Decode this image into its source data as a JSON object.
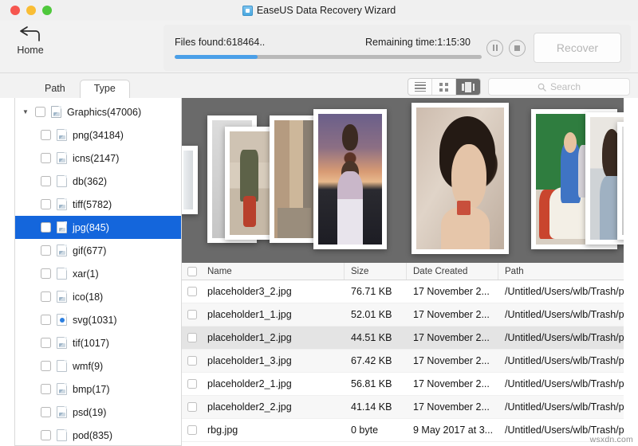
{
  "window": {
    "title": "EaseUS Data Recovery Wizard",
    "app_icon": "app-icon",
    "traffic_lights": [
      "close",
      "minimize",
      "maximize"
    ]
  },
  "toolbar": {
    "home_label": "Home",
    "progress": {
      "files_found": "Files found:618464..",
      "remaining_time": "Remaining time:1:15:30",
      "percent": 27
    },
    "pause_label": "Pause",
    "stop_label": "Stop",
    "recover_label": "Recover"
  },
  "tabs": [
    {
      "label": "Path",
      "active": false
    },
    {
      "label": "Type",
      "active": true
    }
  ],
  "view_controls": {
    "buttons": [
      {
        "name": "list-view",
        "active": false
      },
      {
        "name": "grid-view",
        "active": false
      },
      {
        "name": "coverflow-view",
        "active": true
      }
    ]
  },
  "search": {
    "placeholder": "Search",
    "value": ""
  },
  "sidebar": {
    "root": {
      "label": "Graphics(47006)",
      "expanded": true,
      "checked": false,
      "icon": "image-file-icon"
    },
    "items": [
      {
        "label": "png(34184)",
        "icon": "image-file-icon",
        "selected": false
      },
      {
        "label": "icns(2147)",
        "icon": "image-file-icon",
        "selected": false
      },
      {
        "label": "db(362)",
        "icon": "blank-file-icon",
        "selected": false
      },
      {
        "label": "tiff(5782)",
        "icon": "image-file-icon",
        "selected": false
      },
      {
        "label": "jpg(845)",
        "icon": "image-file-icon",
        "selected": true
      },
      {
        "label": "gif(677)",
        "icon": "image-file-icon",
        "selected": false
      },
      {
        "label": "xar(1)",
        "icon": "blank-file-icon",
        "selected": false
      },
      {
        "label": "ico(18)",
        "icon": "image-file-icon",
        "selected": false
      },
      {
        "label": "svg(1031)",
        "icon": "dot-file-icon",
        "selected": false
      },
      {
        "label": "tif(1017)",
        "icon": "image-file-icon",
        "selected": false
      },
      {
        "label": "wmf(9)",
        "icon": "blank-file-icon",
        "selected": false
      },
      {
        "label": "bmp(17)",
        "icon": "image-file-icon",
        "selected": false
      },
      {
        "label": "psd(19)",
        "icon": "image-file-icon",
        "selected": false
      },
      {
        "label": "pod(835)",
        "icon": "blank-file-icon",
        "selected": false
      }
    ]
  },
  "preview": {
    "photos": [
      {
        "name": "photo-edge",
        "art": "art-edge"
      },
      {
        "name": "photo-wall-far",
        "art": "art-plain"
      },
      {
        "name": "photo-man",
        "art": "art-man"
      },
      {
        "name": "photo-wall",
        "art": "art-wall"
      },
      {
        "name": "photo-beach-father-daughter",
        "art": "art-beach"
      },
      {
        "name": "photo-girl-portrait",
        "art": "art-blur"
      },
      {
        "name": "photo-kids-carousel",
        "art": "art-horse"
      },
      {
        "name": "photo-lady",
        "art": "art-lady"
      },
      {
        "name": "photo-far-right",
        "art": "art-plain"
      }
    ]
  },
  "table": {
    "columns": [
      "Name",
      "Size",
      "Date Created",
      "Path"
    ],
    "rows": [
      {
        "name": "placeholder3_2.jpg",
        "size": "76.71 KB",
        "date": "17 November 2...",
        "path": "/Untitled/Users/wlb/Trash/paul'...",
        "highlighted": false
      },
      {
        "name": "placeholder1_1.jpg",
        "size": "52.01 KB",
        "date": "17 November 2...",
        "path": "/Untitled/Users/wlb/Trash/paul'...",
        "highlighted": false
      },
      {
        "name": "placeholder1_2.jpg",
        "size": "44.51 KB",
        "date": "17 November 2...",
        "path": "/Untitled/Users/wlb/Trash/paul'...",
        "highlighted": true
      },
      {
        "name": "placeholder1_3.jpg",
        "size": "67.42 KB",
        "date": "17 November 2...",
        "path": "/Untitled/Users/wlb/Trash/paul'...",
        "highlighted": false
      },
      {
        "name": "placeholder2_1.jpg",
        "size": "56.81 KB",
        "date": "17 November 2...",
        "path": "/Untitled/Users/wlb/Trash/paul'...",
        "highlighted": false
      },
      {
        "name": "placeholder2_2.jpg",
        "size": "41.14 KB",
        "date": "17 November 2...",
        "path": "/Untitled/Users/wlb/Trash/paul'...",
        "highlighted": false
      },
      {
        "name": "rbg.jpg",
        "size": "0 byte",
        "date": "9 May 2017 at 3...",
        "path": "/Untitled/Users/wlb/Trash/paul'...",
        "highlighted": false
      }
    ]
  },
  "watermark": "wsxdn.com",
  "colors": {
    "accent_blue": "#4a9fe8",
    "selection_blue": "#1466dc",
    "preview_bg": "#6a6a6a",
    "window_bg": "#f2f2f2"
  }
}
